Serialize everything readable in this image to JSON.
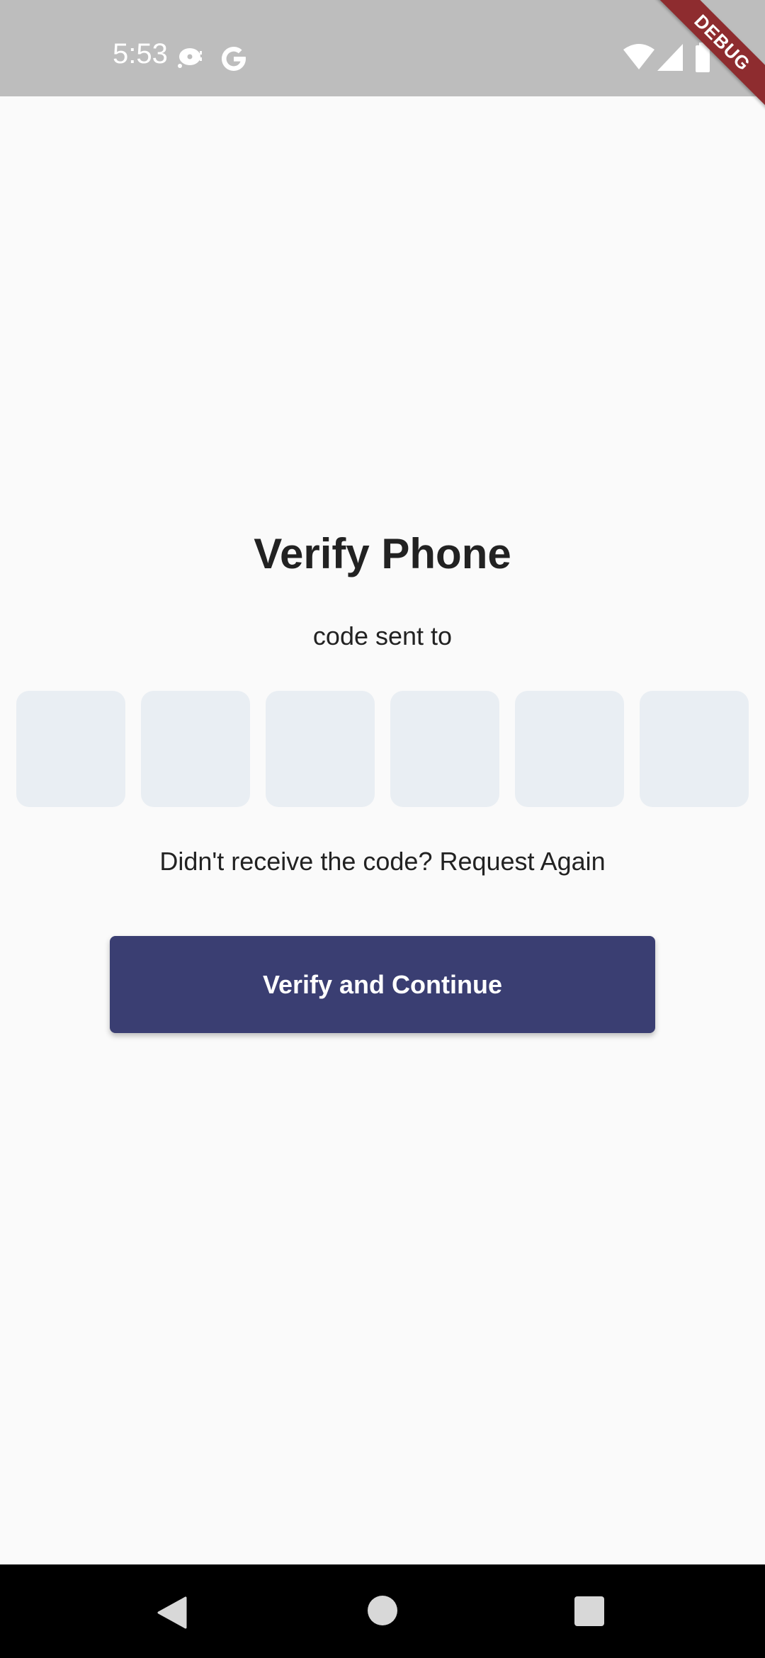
{
  "status_bar": {
    "time": "5:53",
    "icons": [
      "media-icon",
      "google-icon",
      "wifi-icon",
      "signal-icon",
      "battery-icon"
    ]
  },
  "debug_banner": "DEBUG",
  "screen": {
    "title": "Verify Phone",
    "subtitle": "code sent to",
    "otp_boxes": [
      "",
      "",
      "",
      "",
      "",
      ""
    ],
    "resend_text": "Didn't receive the code? Request Again",
    "verify_button": "Verify and Continue"
  },
  "colors": {
    "primary_button": "#3a3e72",
    "otp_box_fill": "#e9eef3",
    "background": "#fafafa",
    "status_bar": "#bdbdbd",
    "debug_ribbon": "#8e2c2f"
  },
  "nav_bar": {
    "icons": [
      "back-icon",
      "home-icon",
      "recent-apps-icon"
    ]
  }
}
